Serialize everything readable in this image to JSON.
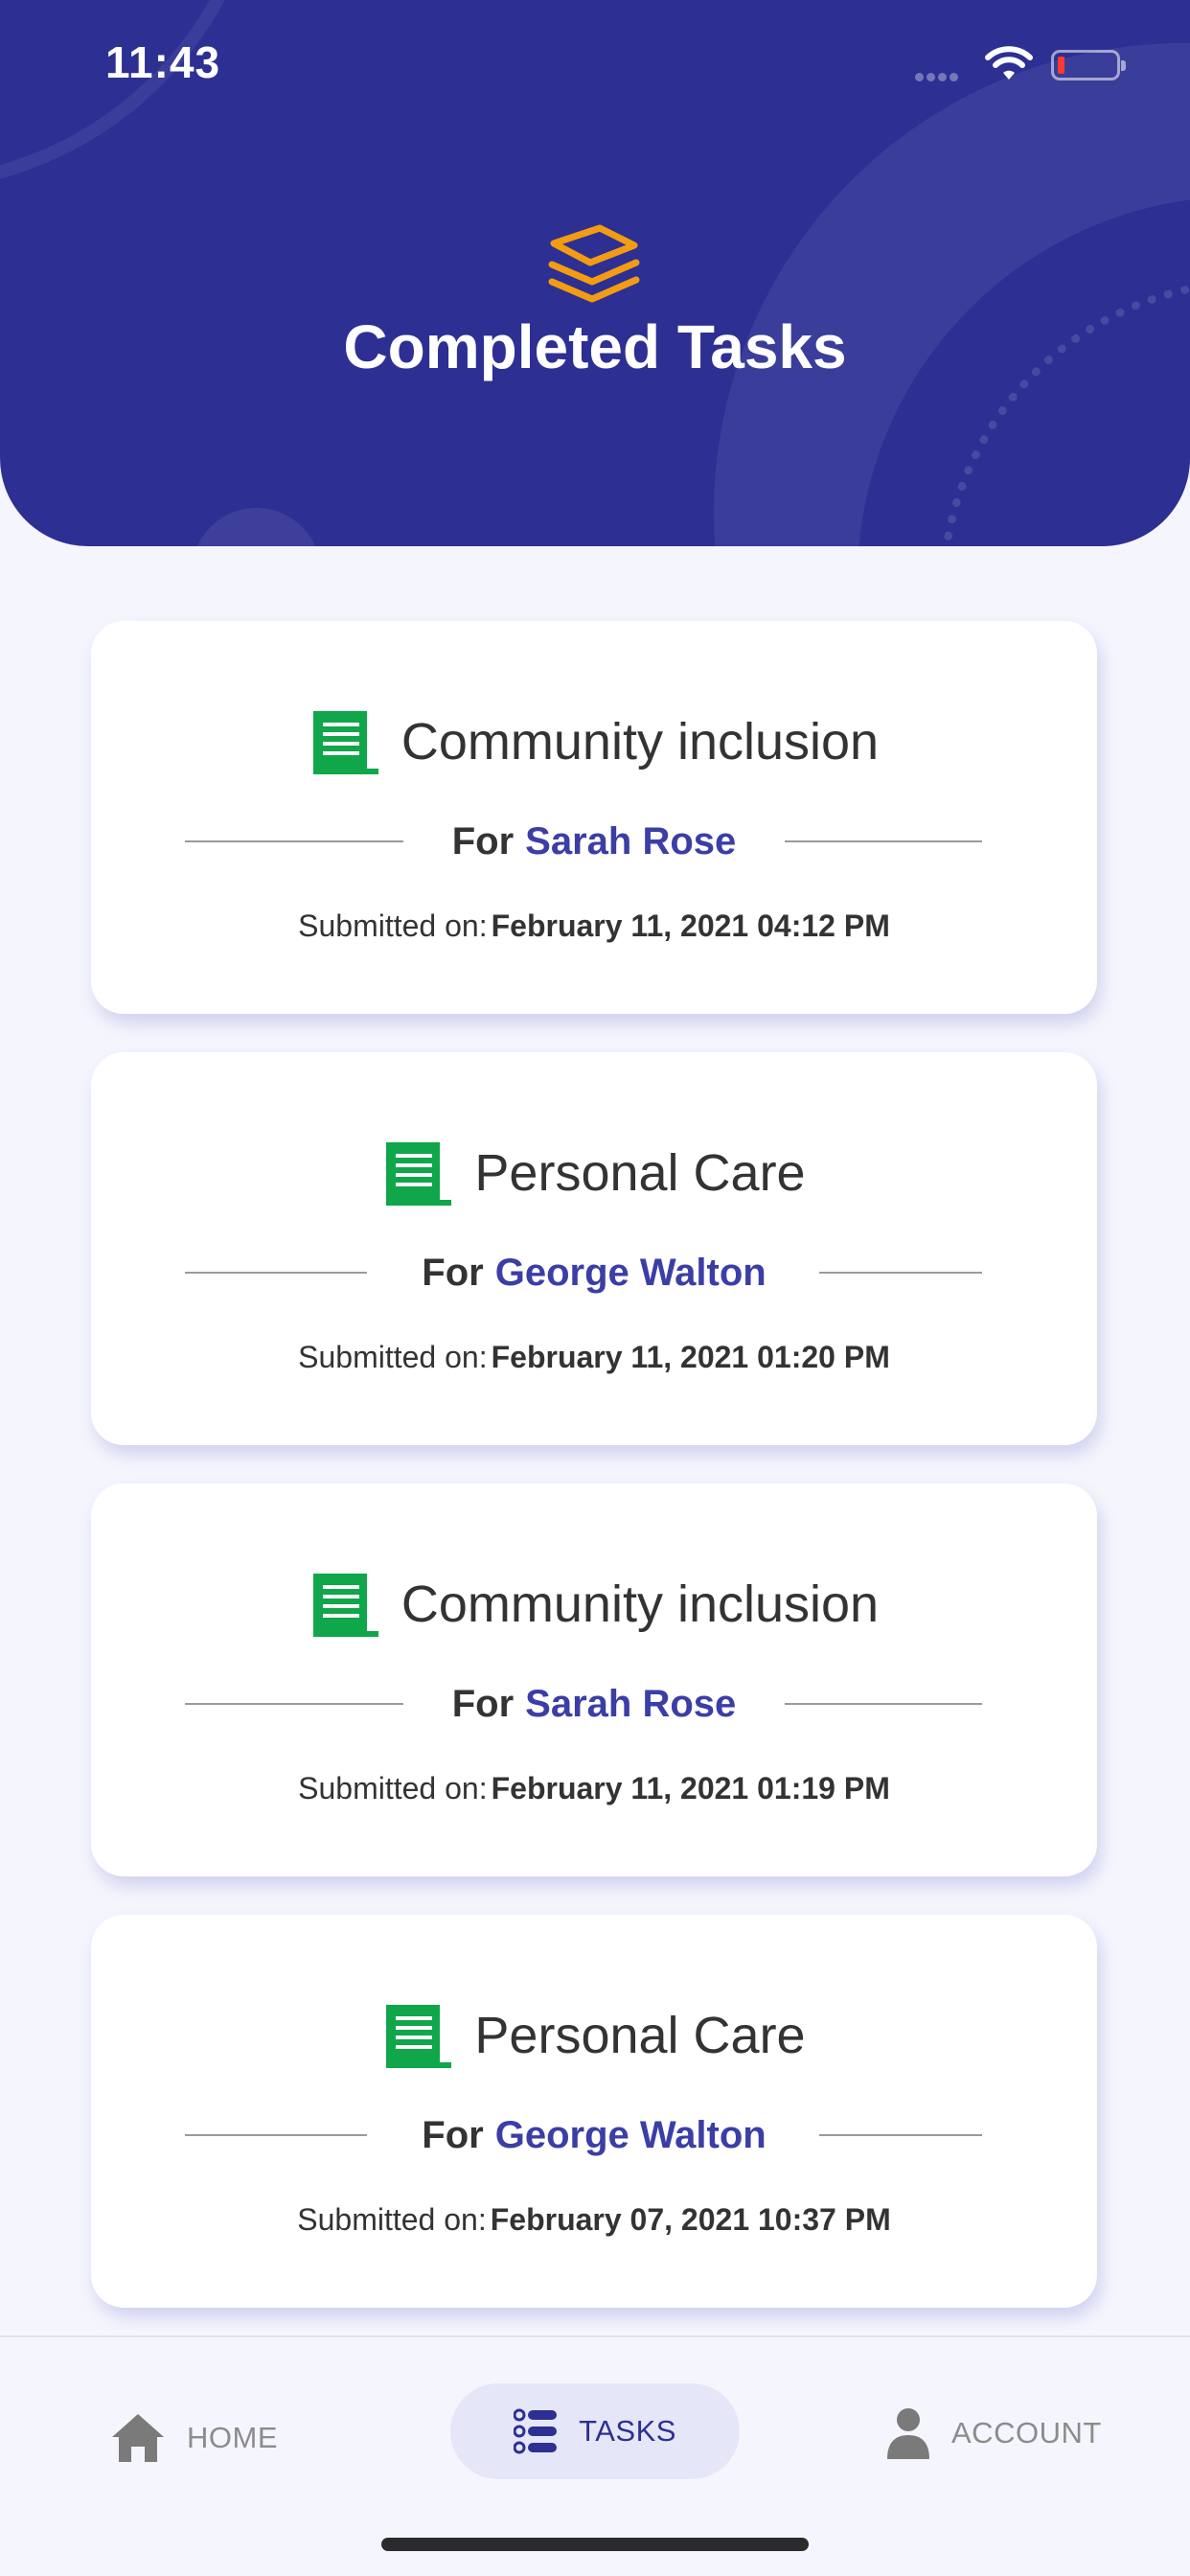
{
  "status_bar": {
    "time": "11:43"
  },
  "header": {
    "title": "Completed Tasks",
    "icon": "layers-icon",
    "accent_color": "#f39c12",
    "background_color": "#2d2f93"
  },
  "tasks": [
    {
      "title": "Community inclusion",
      "for_label": "For",
      "client_name": "Sarah Rose",
      "submitted_label": "Submitted on:",
      "submitted_value": "February 11, 2021 04:12 PM"
    },
    {
      "title": "Personal Care",
      "for_label": "For",
      "client_name": "George Walton",
      "submitted_label": "Submitted on:",
      "submitted_value": "February 11, 2021 01:20 PM"
    },
    {
      "title": "Community inclusion",
      "for_label": "For",
      "client_name": "Sarah Rose",
      "submitted_label": "Submitted on:",
      "submitted_value": "February 11, 2021 01:19 PM"
    },
    {
      "title": "Personal Care",
      "for_label": "For",
      "client_name": "George Walton",
      "submitted_label": "Submitted on:",
      "submitted_value": "February 07, 2021 10:37 PM"
    }
  ],
  "task_icon": "document-icon",
  "task_icon_color": "#10a64a",
  "name_color": "#3b3ea6",
  "nav": {
    "home": "HOME",
    "tasks": "TASKS",
    "account": "ACCOUNT",
    "active": "tasks"
  }
}
